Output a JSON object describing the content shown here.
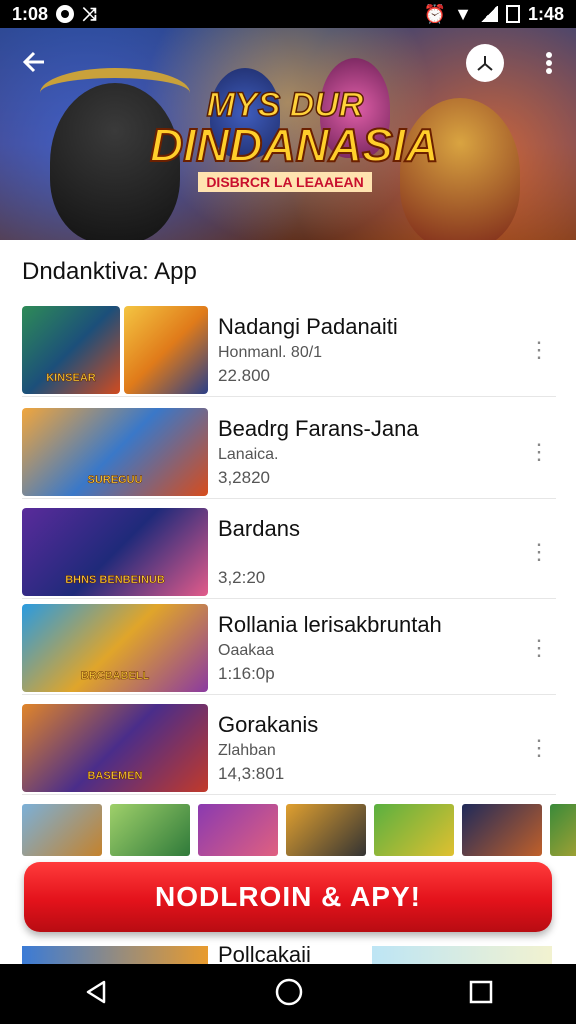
{
  "status_bar": {
    "time": "1:08",
    "right_text": "1:48"
  },
  "hero": {
    "title_line1": "MYS DUR",
    "title_line2": "DINDANASIA",
    "subtitle": "DISBRCR LA LEAAEAN"
  },
  "section_title": "Dndanktiva: App",
  "apps": [
    {
      "name": "Nadangi Padanaiti",
      "line2": "Honmanl. 80/1",
      "line3": "22.800",
      "thumb_text": "KINSEAR"
    },
    {
      "name": "Beadrg Farans-Jana",
      "line2": "Lanaica.",
      "line3": "3,2820",
      "thumb_text": "SUREGUU"
    },
    {
      "name": "Bardans",
      "line2": "",
      "line3": "3,2:20",
      "thumb_text": "BHNS BENBEINUB"
    },
    {
      "name": "Rollania lerisakbruntah",
      "line2": "Oaakaa",
      "line3": "1:16:0p",
      "thumb_text": "BRCBABELL"
    },
    {
      "name": "Gorakanis",
      "line2": "Zlahban",
      "line3": "14,3:801",
      "thumb_text": "BASEMEN"
    }
  ],
  "cta_label": "NODLROIN & APY!",
  "partial_row_label": "Pollcakaii",
  "colors": {
    "cta": "#e3121b",
    "accent_gold": "#ffd23a"
  },
  "icons": [
    "back-arrow-icon",
    "share-icon",
    "more-vert-icon",
    "nav-back-icon",
    "nav-home-icon",
    "nav-recents-icon"
  ]
}
